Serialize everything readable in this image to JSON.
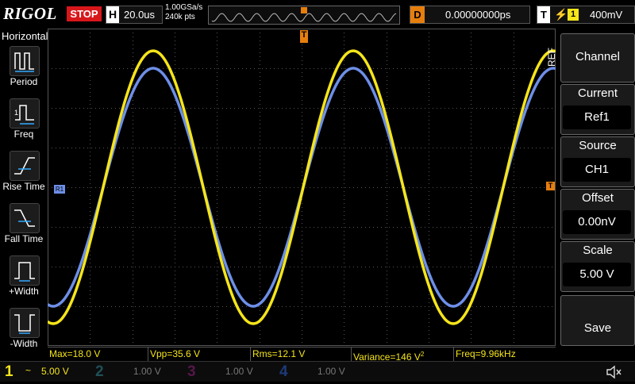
{
  "brand": "RIGOL",
  "run_state": "STOP",
  "horizontal": {
    "label": "H",
    "timebase": "20.0us",
    "sample_rate": "1.00GSa/s",
    "mem_depth": "240k pts"
  },
  "delay": {
    "label": "D",
    "value": "0.00000000ps"
  },
  "trigger": {
    "label": "T",
    "channel": "1",
    "level": "400mV",
    "color": "#f5e51a"
  },
  "left_menu": {
    "title": "Horizontal",
    "items": [
      {
        "label": "Period",
        "icon": "period-icon"
      },
      {
        "label": "Freq",
        "icon": "freq-icon"
      },
      {
        "label": "Rise Time",
        "icon": "rise-time-icon"
      },
      {
        "label": "Fall Time",
        "icon": "fall-time-icon"
      },
      {
        "label": "+Width",
        "icon": "plus-width-icon"
      },
      {
        "label": "-Width",
        "icon": "minus-width-icon"
      }
    ]
  },
  "right_menu": {
    "side_label": "REF",
    "channel_button": "Channel",
    "current_title": "Current",
    "current_value": "Ref1",
    "source_title": "Source",
    "source_value": "CH1",
    "offset_title": "Offset",
    "offset_value": "0.00nV",
    "scale_title": "Scale",
    "scale_value": "5.00 V",
    "save_button": "Save"
  },
  "markers": {
    "ref_marker": "R1",
    "trigger_pos": "T"
  },
  "measurements": {
    "max": "Max=18.0 V",
    "vpp": "Vpp=35.6 V",
    "rms": "Rms=12.1 V",
    "variance": "Variance=146 V",
    "variance_sup": "2",
    "freq": "Freq=9.96kHz"
  },
  "channels": [
    {
      "num": "1",
      "coupling": "~",
      "scale": "5.00 V",
      "color": "#f5e51a"
    },
    {
      "num": "2",
      "scale": "1.00 V",
      "color": "#22b3c7"
    },
    {
      "num": "3",
      "scale": "1.00 V",
      "color": "#c0209a"
    },
    {
      "num": "4",
      "scale": "1.00 V",
      "color": "#2a5fd8"
    }
  ],
  "colors": {
    "ch1": "#f5e51a",
    "ref": "#6d8fe8",
    "stop": "#d8171b",
    "delay": "#e67e0e",
    "grid": "#555555"
  }
}
